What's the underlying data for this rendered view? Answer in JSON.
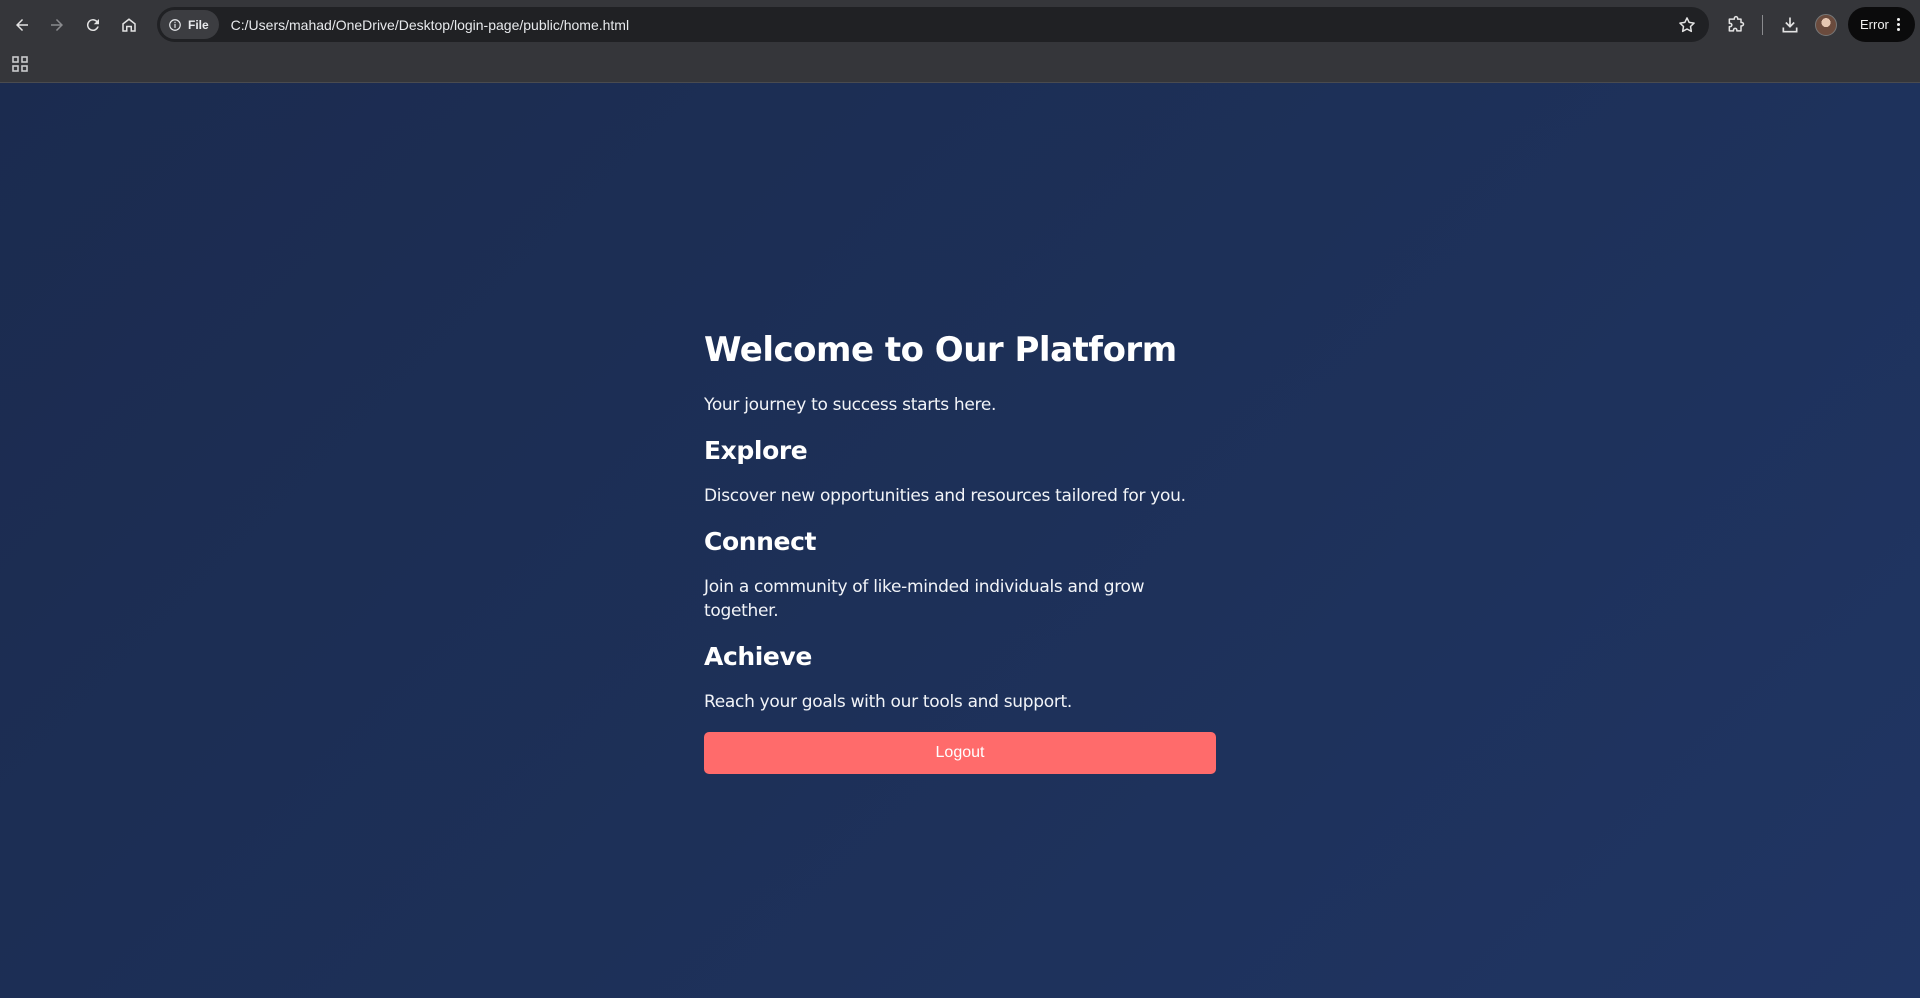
{
  "browser": {
    "site_chip_label": "File",
    "url": "C:/Users/mahad/OneDrive/Desktop/login-page/public/home.html",
    "profile_status": "Error",
    "icons": [
      "back-icon",
      "forward-icon",
      "reload-icon",
      "home-icon",
      "info-icon",
      "star-icon",
      "extensions-icon",
      "download-icon",
      "avatar",
      "more-icon",
      "apps-icon"
    ]
  },
  "page": {
    "title": "Welcome to Our Platform",
    "subtitle": "Your journey to success starts here.",
    "sections": [
      {
        "heading": "Explore",
        "text": "Discover new opportunities and resources tailored for you."
      },
      {
        "heading": "Connect",
        "text": "Join a community of like-minded individuals and grow together."
      },
      {
        "heading": "Achieve",
        "text": "Reach your goals with our tools and support."
      }
    ],
    "logout_label": "Logout"
  },
  "colors": {
    "background": "#1c2d55",
    "button": "#ff6b6b",
    "chrome": "#35363a"
  }
}
